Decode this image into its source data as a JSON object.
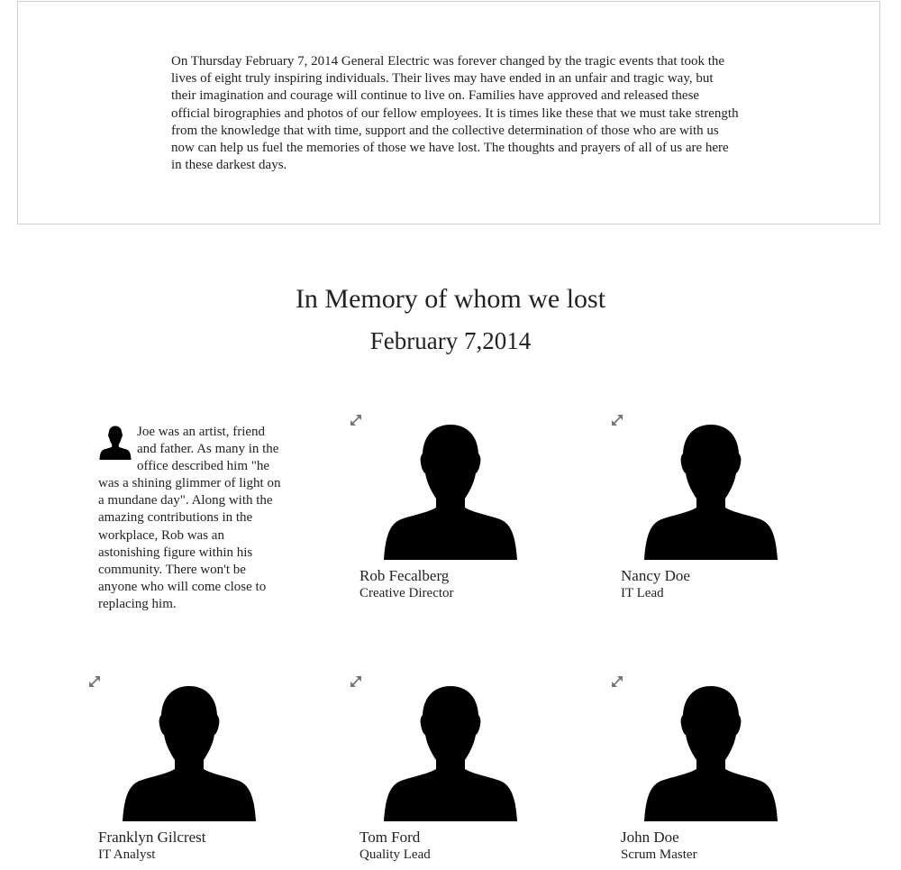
{
  "intro": {
    "text": "On Thursday February 7, 2014 General Electric was forever changed by the tragic events that took the lives of eight truly inspiring individuals. Their lives may have ended in an unfair and tragic way, but their imagination and courage will continue to live on. Families have approved and released these official birographies and photos of our fellow employees. It is times like these that we must take strength from the knowledge that with time, support and the collective determination of those who are with us now can help us fuel the memories of those we have lost. The thoughts and prayers of all of us are here in these darkest days."
  },
  "memorial": {
    "title": "In Memory of whom we lost",
    "date": "February 7,2014"
  },
  "bio": {
    "text": "Joe was an artist, friend and father. As many in the office described him \"he was a shining glimmer of light on a mundane day\". Along with the amazing contributions in the workplace, Rob was an astonishing figure within his community. There won't be anyone who will come close to replacing him."
  },
  "people": [
    {
      "name": "Rob Fecalberg",
      "role": "Creative Director"
    },
    {
      "name": "Nancy Doe",
      "role": "IT Lead"
    },
    {
      "name": "Franklyn  Gilcrest",
      "role": "IT Analyst"
    },
    {
      "name": "Tom Ford",
      "role": "Quality Lead"
    },
    {
      "name": "John Doe",
      "role": "Scrum Master"
    }
  ],
  "icons": {
    "expand": "expand-arrows-icon",
    "portrait": "person-silhouette-icon"
  },
  "colors": {
    "text": "#222222",
    "border": "#cfcfcf",
    "silhouette": "#000000",
    "icon": "#777777"
  }
}
